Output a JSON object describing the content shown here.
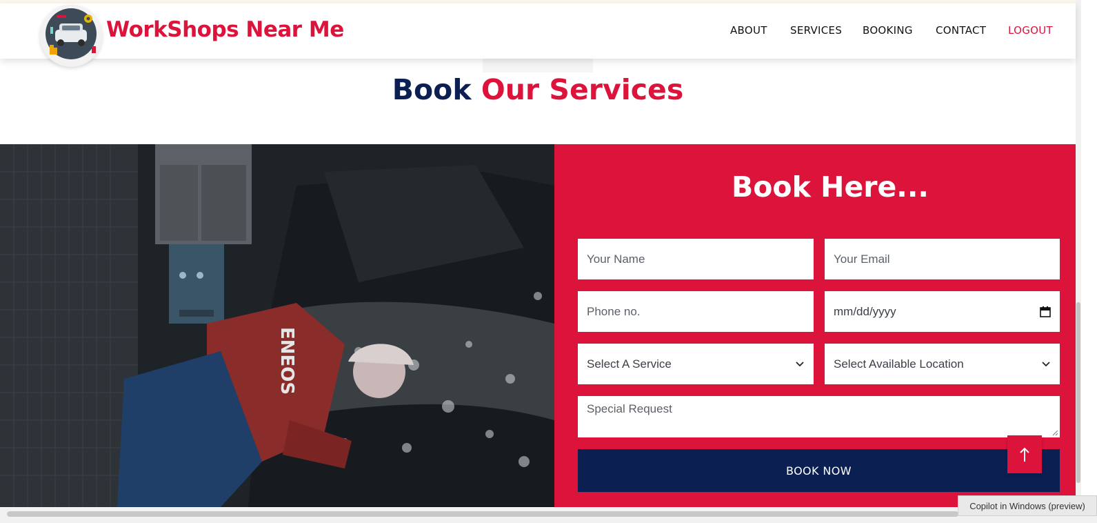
{
  "brand": {
    "name": "WorkShops Near Me",
    "color": "#dc143c"
  },
  "nav": {
    "items": [
      {
        "label": "ABOUT"
      },
      {
        "label": "SERVICES"
      },
      {
        "label": "BOOKING"
      },
      {
        "label": "CONTACT"
      },
      {
        "label": "LOGOUT"
      }
    ]
  },
  "page_title": {
    "part1": "Book",
    "part2": "Our Services"
  },
  "photo": {
    "text": "ENEOS"
  },
  "form": {
    "title": "Book Here...",
    "name_placeholder": "Your Name",
    "email_placeholder": "Your Email",
    "phone_placeholder": "Phone no.",
    "date_placeholder": "mm/dd/yyyy",
    "service_select": "Select A Service",
    "location_select": "Select Available Location",
    "special_placeholder": "Special Request",
    "submit_label": "BOOK NOW"
  },
  "back_to_top": {
    "icon": "arrow-up-icon"
  },
  "system": {
    "copilot_label": "Copilot in Windows (preview)"
  },
  "colors": {
    "accent": "#dc143c",
    "navy": "#0b1f52"
  }
}
